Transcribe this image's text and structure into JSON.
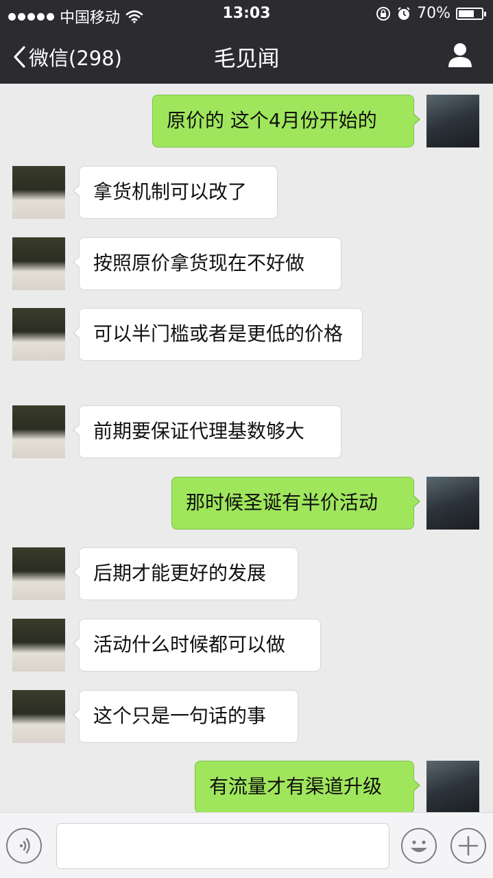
{
  "status_bar": {
    "carrier": "中国移动",
    "time": "13:03",
    "battery_text": "70%",
    "battery_level": 0.7
  },
  "nav": {
    "back_label": "微信(298)",
    "title": "毛见闻"
  },
  "messages": [
    {
      "side": "out",
      "text": "原价的 这个4月份开始的",
      "avatar": "self-avatar"
    },
    {
      "side": "in",
      "text": "拿货机制可以改了",
      "avatar": "contact-avatar"
    },
    {
      "side": "in",
      "text": "按照原价拿货现在不好做",
      "avatar": "contact-avatar"
    },
    {
      "side": "in",
      "text": "可以半门槛或者是更低的价格",
      "avatar": "contact-avatar"
    },
    {
      "side": "in",
      "text": "前期要保证代理基数够大",
      "avatar": "contact-avatar"
    },
    {
      "side": "out",
      "text": "那时候圣诞有半价活动",
      "avatar": "self-avatar"
    },
    {
      "side": "in",
      "text": "后期才能更好的发展",
      "avatar": "contact-avatar"
    },
    {
      "side": "in",
      "text": "活动什么时候都可以做",
      "avatar": "contact-avatar"
    },
    {
      "side": "in",
      "text": "这个只是一句话的事",
      "avatar": "contact-avatar"
    },
    {
      "side": "out",
      "text": "有流量才有渠道升级",
      "avatar": "self-avatar"
    }
  ],
  "input": {
    "value": "",
    "placeholder": ""
  },
  "icons": {
    "signal": "signal-dots-icon",
    "wifi": "wifi-icon",
    "orientation_lock": "orientation-lock-icon",
    "alarm": "alarm-icon",
    "battery": "battery-icon",
    "back": "chevron-left-icon",
    "profile": "person-icon",
    "voice": "voice-icon",
    "emoji": "emoji-icon",
    "more": "plus-icon"
  },
  "colors": {
    "bar_bg": "#2b2b30",
    "chat_bg": "#ebebeb",
    "outgoing_bubble": "#9fe65c",
    "incoming_bubble": "#ffffff"
  }
}
